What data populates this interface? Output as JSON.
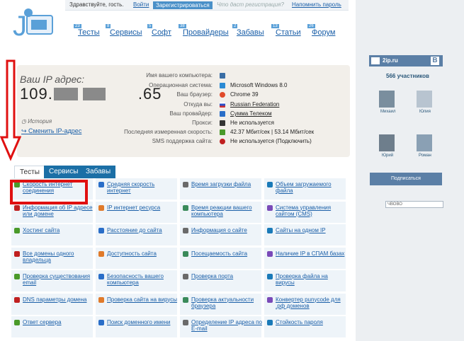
{
  "header": {
    "greeting": "Здравствуйте, гость.",
    "login": "Войти",
    "register": "Зарегистрироваться",
    "why_register": "Что даст регистрация?",
    "remind_password": "Напомнить пароль"
  },
  "nav": {
    "items": [
      {
        "label": "Тесты",
        "count": "23"
      },
      {
        "label": "Сервисы",
        "count": "8"
      },
      {
        "label": "Софт",
        "count": "5"
      },
      {
        "label": "Провайдеры",
        "count": "38"
      },
      {
        "label": "Забавы",
        "count": "2"
      },
      {
        "label": "Статьи",
        "count": "13"
      },
      {
        "label": "Форум",
        "count": "26"
      }
    ]
  },
  "ip": {
    "label": "Ваш IP адрес:",
    "part1": "109.",
    "part4": ".65",
    "history": "История",
    "change_ip": "Сменить IP-адрес"
  },
  "info": [
    {
      "key": "Имя вашего компьютера:",
      "value": "",
      "color": "#3a6ea5"
    },
    {
      "key": "Операционная система:",
      "value": "Microsoft Windows 8.0",
      "color": "#2a8ad4"
    },
    {
      "key": "Ваш браузер:",
      "value": "Chrome 39",
      "color": "#e04a2a"
    },
    {
      "key": "Откуда вы:",
      "value": "Russian Federation",
      "color": "#d03030"
    },
    {
      "key": "Ваш провайдер:",
      "value": "Сумма Телеком",
      "color": "#2a6ec8"
    },
    {
      "key": "Прокси:",
      "value": "Не используется",
      "color": "#333333"
    },
    {
      "key": "Последняя измеренная скорость:",
      "value": "42.37 Мбит/сек | 53.14 Мбит/сек",
      "color": "#4a9a2a"
    },
    {
      "key": "SMS поддержка сайта:",
      "value": "Не используется (Подключить)",
      "color": "#c02020"
    }
  ],
  "tabs": {
    "tests": "Тесты",
    "services": "Сервисы",
    "zabavy": "Забавы"
  },
  "tools": [
    [
      "Скорость интернет соединения",
      "Средняя скорость интернет",
      "Время загрузки файла",
      "Объем загружаемого файла"
    ],
    [
      "Информация об IP адресе или домене",
      "IP интернет ресурса",
      "Время реакции вашего компьютера",
      "Система управления сайтом (CMS)"
    ],
    [
      "Хостинг сайта",
      "Расстояние до сайта",
      "Информация о сайте",
      "Сайты на одном IP"
    ],
    [
      "Все домены одного владельца",
      "Доступность сайта",
      "Посещаемость сайта",
      "Наличие IP в СПАМ базах"
    ],
    [
      "Проверка существования email",
      "Безопасность вашего компьютера",
      "Проверка порта",
      "Проверка файла на вирусы"
    ],
    [
      "DNS параметры домена",
      "Проверка сайта на вирусы",
      "Проверка актуальности браузера",
      "Конвертер punycode для .рф доменов"
    ],
    [
      "Ответ сервера",
      "Поиск доменного имени",
      "Определение IP адреса по E-mail",
      "Стойкость пароля"
    ]
  ],
  "sidebar": {
    "vk_name": "2ip.ru",
    "vk_badge": "B",
    "members": "566 участников",
    "people": [
      "Михаил",
      "Юлия",
      "Юрий",
      "Роман"
    ],
    "subscribe": "Подписаться",
    "search_hint": "ЧВОВО"
  },
  "colors": {
    "accent": "#1b6fa6",
    "link": "#1a5fa8",
    "highlight_box": "#e01010"
  }
}
